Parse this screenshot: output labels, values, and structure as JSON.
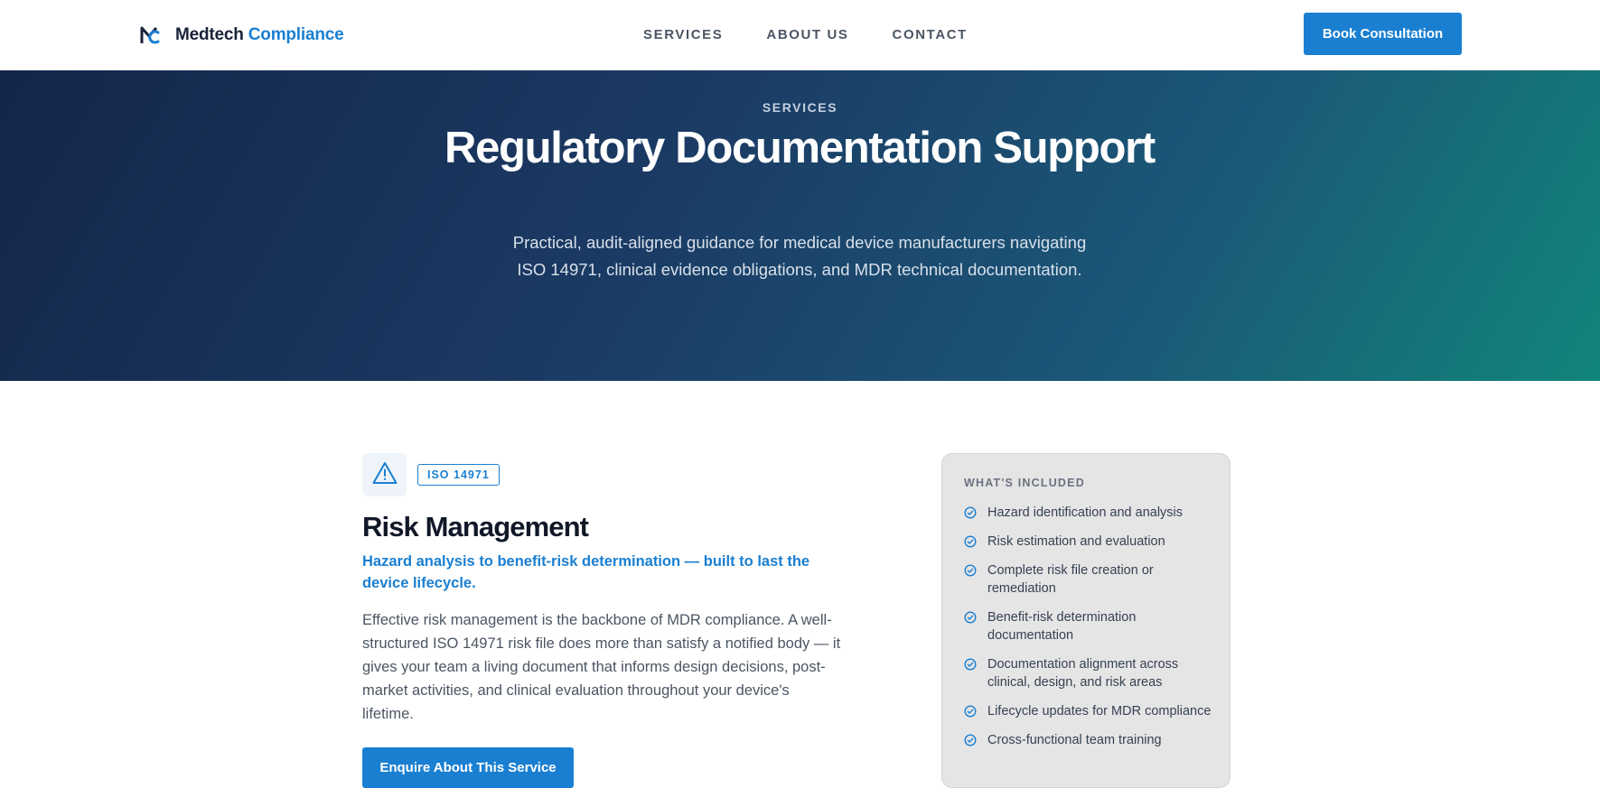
{
  "brand": {
    "name_primary": "Medtech",
    "name_accent": "Compliance",
    "logo_icon": "mc-monogram-icon"
  },
  "nav": {
    "items": [
      {
        "label": "SERVICES"
      },
      {
        "label": "ABOUT US"
      },
      {
        "label": "CONTACT"
      }
    ]
  },
  "header": {
    "cta_label": "Book Consultation"
  },
  "hero": {
    "eyebrow": "SERVICES",
    "title": "Regulatory Documentation Support",
    "subtitle": "Practical, audit-aligned guidance for medical device manufacturers navigating ISO 14971, clinical evidence obligations, and MDR technical documentation."
  },
  "service": {
    "icon": "warning-triangle-icon",
    "badge": "ISO 14971",
    "title": "Risk Management",
    "tagline": "Hazard analysis to benefit-risk determination — built to last the device lifecycle.",
    "description": "Effective risk management is the backbone of MDR compliance. A well-structured ISO 14971 risk file does more than satisfy a notified body — it gives your team a living document that informs design decisions, post-market activities, and clinical evaluation throughout your device's lifetime.",
    "cta_label": "Enquire About This Service"
  },
  "included": {
    "heading": "WHAT'S INCLUDED",
    "items": [
      "Hazard identification and analysis",
      "Risk estimation and evaluation",
      "Complete risk file creation or remediation",
      "Benefit-risk determination documentation",
      "Documentation alignment across clinical, design, and risk areas",
      "Lifecycle updates for MDR compliance",
      "Cross-functional team training"
    ]
  },
  "colors": {
    "accent": "#1a7fd1",
    "navy": "#14264a",
    "teal": "#11857a",
    "panel": "#e5e5e6"
  }
}
